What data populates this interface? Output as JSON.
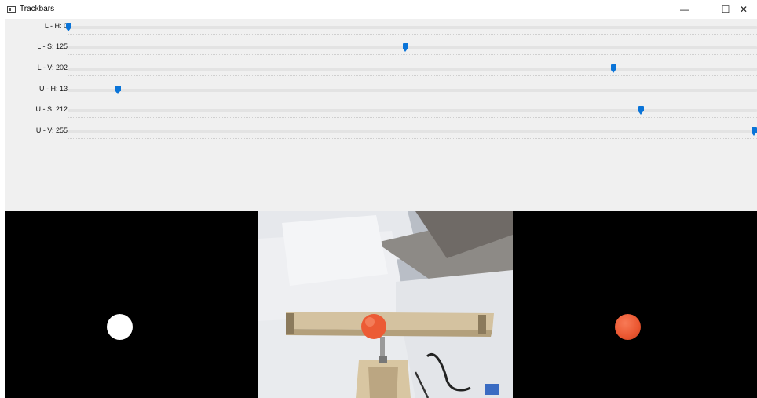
{
  "window": {
    "title": "Trackbars",
    "minimize_glyph": "—",
    "maximize_glyph": "☐",
    "close_glyph": "✕"
  },
  "trackbars": [
    {
      "label": "L - H: 0",
      "value": 0,
      "max": 179
    },
    {
      "label": "L - S: 125",
      "value": 125,
      "max": 255
    },
    {
      "label": "L - V: 202",
      "value": 202,
      "max": 255
    },
    {
      "label": "U - H: 13",
      "value": 13,
      "max": 179
    },
    {
      "label": "U - S: 212",
      "value": 212,
      "max": 255
    },
    {
      "label": "U - V: 255",
      "value": 255,
      "max": 255
    }
  ],
  "colors": {
    "thumb": "#0a74d8",
    "ball": "#ea5630",
    "panel": "#f0f0f0"
  },
  "images": {
    "mask_icon": "white-blob",
    "camera_icon": "camera-frame",
    "result_icon": "orange-ball"
  }
}
